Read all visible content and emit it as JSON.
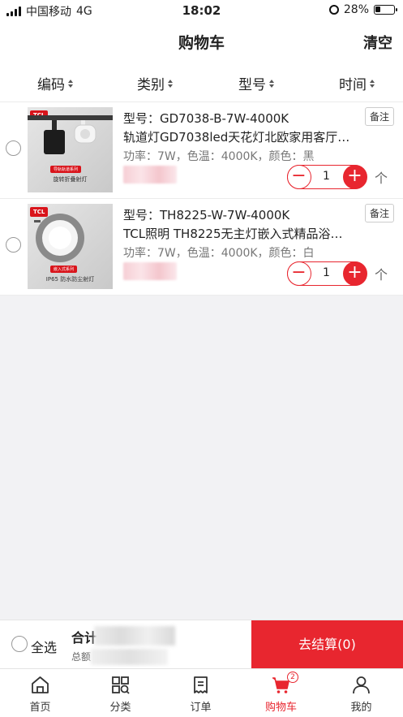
{
  "status": {
    "carrier": "中国移动",
    "network": "4G",
    "time": "18:02",
    "battery": "28%",
    "battery_level": 0.28
  },
  "header": {
    "title": "购物车",
    "clear_label": "清空"
  },
  "sort": [
    {
      "label": "编码"
    },
    {
      "label": "类别"
    },
    {
      "label": "型号"
    },
    {
      "label": "时间"
    }
  ],
  "items": [
    {
      "model": "型号：GD7038-B-7W-4000K",
      "name": "轨道灯GD7038led天花灯北欧家用客厅…",
      "spec": "功率：7W，色温：4000K，颜色：黑",
      "note_label": "备注",
      "quantity": "1",
      "top_arrow": "个",
      "thumb_brand": "TCL",
      "thumb_tag": "导轨轨道系列",
      "thumb_caption": "旋转折叠射灯"
    },
    {
      "model": "型号：TH8225-W-7W-4000K",
      "name": "TCL照明 TH8225无主灯嵌入式精品浴…",
      "spec": "功率：7W，色温：4000K，颜色：白",
      "note_label": "备注",
      "quantity": "1",
      "top_arrow": "个",
      "thumb_brand": "TCL",
      "thumb_tag": "嵌入式系列",
      "thumb_caption": "IP65 防水防尘射灯"
    }
  ],
  "checkout": {
    "select_all": "全选",
    "total_label": "合计",
    "total_sub": "总额",
    "button_label": "去结算(0)"
  },
  "tabbar": {
    "items": [
      {
        "label": "首页",
        "icon": "home-icon"
      },
      {
        "label": "分类",
        "icon": "category-icon"
      },
      {
        "label": "订单",
        "icon": "order-icon"
      },
      {
        "label": "购物车",
        "icon": "cart-icon",
        "badge": "2",
        "active": true
      },
      {
        "label": "我的",
        "icon": "user-icon"
      }
    ]
  },
  "colors": {
    "accent": "#e8262f"
  }
}
